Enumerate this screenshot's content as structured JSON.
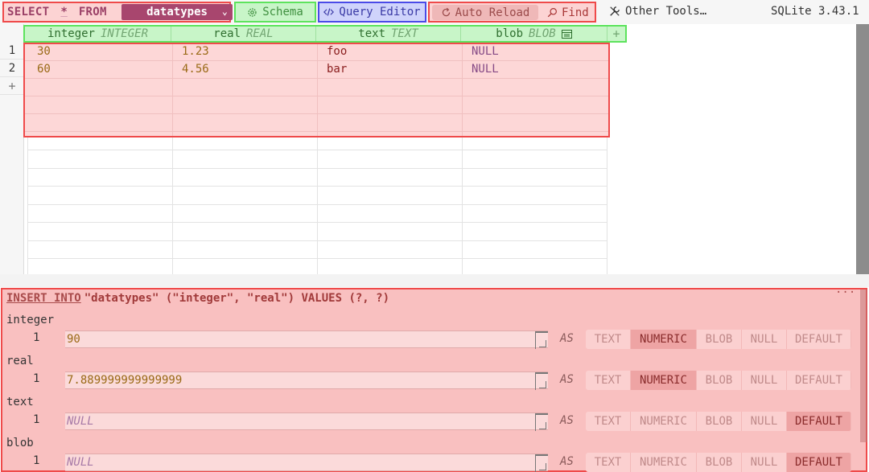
{
  "toolbar": {
    "select_kw": "SELECT",
    "star": "*",
    "from_kw": "FROM",
    "table": "datatypes",
    "schema_label": "Schema",
    "query_editor_label": "Query Editor",
    "auto_reload_label": "Auto Reload",
    "find_label": "Find",
    "other_tools_label": "Other Tools…",
    "version": "SQLite 3.43.1"
  },
  "grid": {
    "columns": [
      {
        "name": "integer",
        "type": "INTEGER"
      },
      {
        "name": "real",
        "type": "REAL"
      },
      {
        "name": "text",
        "type": "TEXT"
      },
      {
        "name": "blob",
        "type": "BLOB"
      }
    ],
    "add_column": "+",
    "rows": [
      {
        "num": "1",
        "integer": "30",
        "real": "1.23",
        "text": "foo",
        "blob": "NULL"
      },
      {
        "num": "2",
        "integer": "60",
        "real": "4.56",
        "text": "bar",
        "blob": "NULL"
      }
    ],
    "add_row": "+"
  },
  "insert": {
    "keyword": "INSERT INTO",
    "statement": "\"datatypes\" (\"integer\", \"real\") VALUES (?, ?)",
    "menu": "···",
    "as_label": "AS",
    "type_options": [
      "TEXT",
      "NUMERIC",
      "BLOB",
      "NULL",
      "DEFAULT"
    ],
    "params": [
      {
        "label": "integer",
        "index": "1",
        "value": "90",
        "is_null": false,
        "selected": "NUMERIC"
      },
      {
        "label": "real",
        "index": "1",
        "value": "7.889999999999999",
        "is_null": false,
        "selected": "NUMERIC"
      },
      {
        "label": "text",
        "index": "1",
        "value": "NULL",
        "is_null": true,
        "selected": "DEFAULT"
      },
      {
        "label": "blob",
        "index": "1",
        "value": "NULL",
        "is_null": true,
        "selected": "DEFAULT"
      }
    ]
  }
}
